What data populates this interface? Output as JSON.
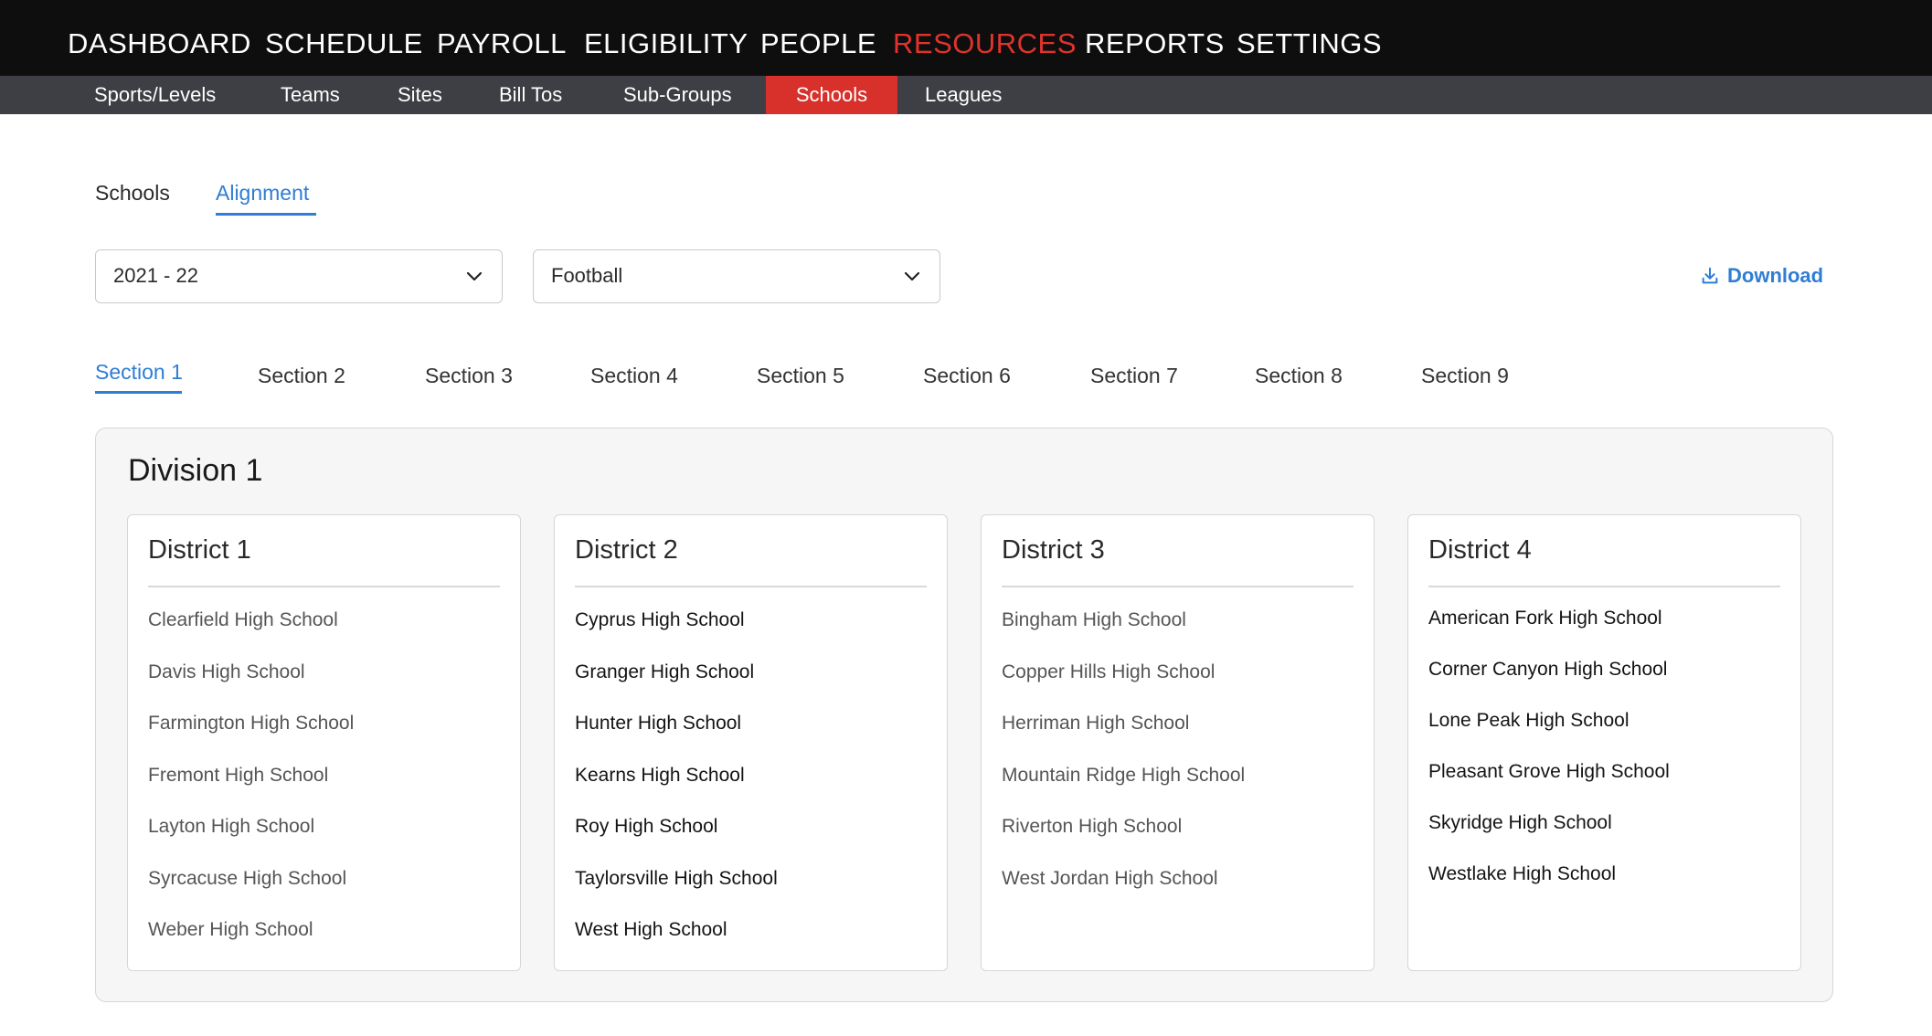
{
  "top_nav": [
    "DASHBOARD",
    "SCHEDULE",
    "PAYROLL",
    "ELIGIBILITY",
    "PEOPLE",
    "RESOURCES",
    "REPORTS",
    "SETTINGS"
  ],
  "top_nav_active": "RESOURCES",
  "sub_nav": [
    "Sports/Levels",
    "Teams",
    "Sites",
    "Bill Tos",
    "Sub-Groups",
    "Schools",
    "Leagues"
  ],
  "sub_nav_active": "Schools",
  "page_tabs": [
    "Schools",
    "Alignment"
  ],
  "page_tabs_active": "Alignment",
  "filters": {
    "season": "2021 - 22",
    "sport": "Football"
  },
  "download_label": "Download",
  "section_tabs": [
    "Section 1",
    "Section 2",
    "Section 3",
    "Section 4",
    "Section 5",
    "Section 6",
    "Section 7",
    "Section 8",
    "Section 9"
  ],
  "section_tabs_active": "Section 1",
  "division": {
    "title": "Division 1",
    "districts": [
      {
        "title": "District 1",
        "schools": [
          "Clearfield High School",
          "Davis High School",
          "Farmington High School",
          "Fremont High School",
          "Layton High School",
          "Syrcacuse High School",
          "Weber High School"
        ]
      },
      {
        "title": "District 2",
        "schools": [
          "Cyprus High School",
          "Granger High School",
          "Hunter High School",
          "Kearns High School",
          "Roy High School",
          "Taylorsville High School",
          "West High School"
        ]
      },
      {
        "title": "District 3",
        "schools": [
          "Bingham High School",
          "Copper Hills High School",
          "Herriman High School",
          "Mountain Ridge High School",
          "Riverton High School",
          "West Jordan High School"
        ]
      },
      {
        "title": "District 4",
        "schools": [
          "American Fork High School",
          "Corner Canyon High School",
          "Lone Peak High School",
          "Pleasant Grove High School",
          "Skyridge High School",
          "Westlake High School"
        ]
      }
    ]
  },
  "colors": {
    "accent_red": "#e0332d",
    "accent_blue": "#2f7dd4",
    "nav_bg": "#0e0e0e",
    "subnav_bg": "#3d3f44"
  },
  "icons": {
    "dropdown": "chevron-down-icon",
    "download": "download-icon"
  }
}
